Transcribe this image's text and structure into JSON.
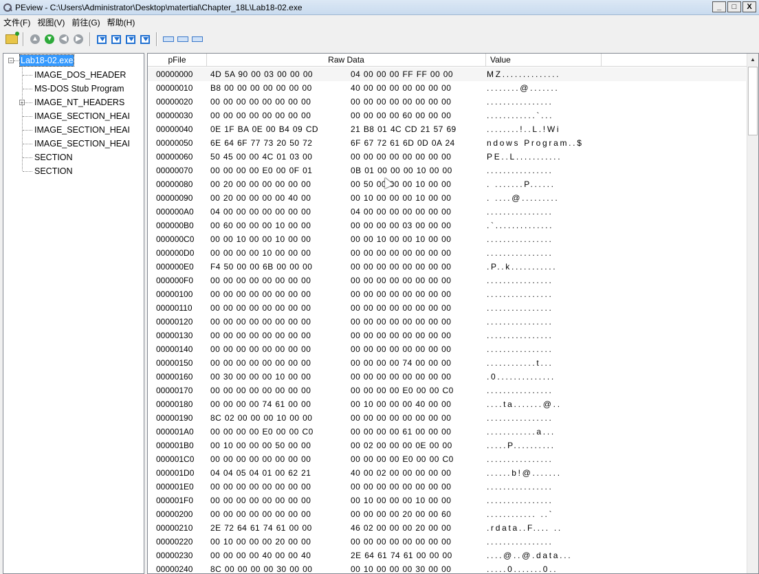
{
  "window": {
    "title": "PEview - C:\\Users\\Administrator\\Desktop\\matertial\\Chapter_18L\\Lab18-02.exe",
    "buttons": {
      "minimize": "_",
      "maximize": "□",
      "close": "X"
    }
  },
  "menu": [
    {
      "label": "文件(F)"
    },
    {
      "label": "视图(V)"
    },
    {
      "label": "前往(G)"
    },
    {
      "label": "帮助(H)"
    }
  ],
  "toolbar": {
    "buttons": [
      "open-file-icon",
      "back-gray-icon",
      "forward-green-icon",
      "prev-gray-icon",
      "next-gray-icon",
      "view-byte-icon",
      "view-word-icon",
      "view-dword-icon",
      "view-address-icon",
      "view-hex-icon",
      "view-ascii-icon",
      "view-sections-icon"
    ]
  },
  "tree": {
    "root": "Lab18-02.exe",
    "items": [
      {
        "label": "IMAGE_DOS_HEADER",
        "expandable": false
      },
      {
        "label": "MS-DOS Stub Program",
        "expandable": false
      },
      {
        "label": "IMAGE_NT_HEADERS",
        "expandable": true
      },
      {
        "label": "IMAGE_SECTION_HEAI",
        "expandable": false
      },
      {
        "label": "IMAGE_SECTION_HEAI",
        "expandable": false
      },
      {
        "label": "IMAGE_SECTION_HEAI",
        "expandable": false
      },
      {
        "label": "SECTION",
        "expandable": false
      },
      {
        "label": "SECTION",
        "expandable": false
      }
    ]
  },
  "hex": {
    "columns": {
      "offset": "pFile",
      "raw": "Raw Data",
      "value": "Value"
    },
    "rows": [
      {
        "off": "00000000",
        "h1": "4D 5A 90 00 03 00 00 00",
        "h2": "04 00 00 00 FF FF 00 00",
        "val": "MZ.............."
      },
      {
        "off": "00000010",
        "h1": "B8 00 00 00 00 00 00 00",
        "h2": "40 00 00 00 00 00 00 00",
        "val": "........@......."
      },
      {
        "off": "00000020",
        "h1": "00 00 00 00 00 00 00 00",
        "h2": "00 00 00 00 00 00 00 00",
        "val": "................"
      },
      {
        "off": "00000030",
        "h1": "00 00 00 00 00 00 00 00",
        "h2": "00 00 00 00 60 00 00 00",
        "val": "............`..."
      },
      {
        "off": "00000040",
        "h1": "0E 1F BA 0E 00 B4 09 CD",
        "h2": "21 B8 01 4C CD 21 57 69",
        "val": "........!..L.!Wi"
      },
      {
        "off": "00000050",
        "h1": "6E 64 6F 77 73 20 50 72",
        "h2": "6F 67 72 61 6D 0D 0A 24",
        "val": "ndows Program..$"
      },
      {
        "off": "00000060",
        "h1": "50 45 00 00 4C 01 03 00",
        "h2": "00 00 00 00 00 00 00 00",
        "val": "PE..L..........."
      },
      {
        "off": "00000070",
        "h1": "00 00 00 00 E0 00 0F 01",
        "h2": "0B 01 00 00 00 10 00 00",
        "val": "................"
      },
      {
        "off": "00000080",
        "h1": "00 20 00 00 00 00 00 00",
        "h2": "00 50 00 00 00 10 00 00",
        "val": ". .......P......"
      },
      {
        "off": "00000090",
        "h1": "00 20 00 00 00 00 40 00",
        "h2": "00 10 00 00 00 10 00 00",
        "val": ". ....@........."
      },
      {
        "off": "000000A0",
        "h1": "04 00 00 00 00 00 00 00",
        "h2": "04 00 00 00 00 00 00 00",
        "val": "................"
      },
      {
        "off": "000000B0",
        "h1": "00 60 00 00 00 10 00 00",
        "h2": "00 00 00 00 03 00 00 00",
        "val": ".`.............."
      },
      {
        "off": "000000C0",
        "h1": "00 00 10 00 00 10 00 00",
        "h2": "00 00 10 00 00 10 00 00",
        "val": "................"
      },
      {
        "off": "000000D0",
        "h1": "00 00 00 00 10 00 00 00",
        "h2": "00 00 00 00 00 00 00 00",
        "val": "................"
      },
      {
        "off": "000000E0",
        "h1": "F4 50 00 00 6B 00 00 00",
        "h2": "00 00 00 00 00 00 00 00",
        "val": ".P..k..........."
      },
      {
        "off": "000000F0",
        "h1": "00 00 00 00 00 00 00 00",
        "h2": "00 00 00 00 00 00 00 00",
        "val": "................"
      },
      {
        "off": "00000100",
        "h1": "00 00 00 00 00 00 00 00",
        "h2": "00 00 00 00 00 00 00 00",
        "val": "................"
      },
      {
        "off": "00000110",
        "h1": "00 00 00 00 00 00 00 00",
        "h2": "00 00 00 00 00 00 00 00",
        "val": "................"
      },
      {
        "off": "00000120",
        "h1": "00 00 00 00 00 00 00 00",
        "h2": "00 00 00 00 00 00 00 00",
        "val": "................"
      },
      {
        "off": "00000130",
        "h1": "00 00 00 00 00 00 00 00",
        "h2": "00 00 00 00 00 00 00 00",
        "val": "................"
      },
      {
        "off": "00000140",
        "h1": "00 00 00 00 00 00 00 00",
        "h2": "00 00 00 00 00 00 00 00",
        "val": "................"
      },
      {
        "off": "00000150",
        "h1": "00 00 00 00 00 00 00 00",
        "h2": "00 00 00 00 74 00 00 00",
        "val": "............t..."
      },
      {
        "off": "00000160",
        "h1": "00 30 00 00 00 10 00 00",
        "h2": "00 00 00 00 00 00 00 00",
        "val": ".0.............."
      },
      {
        "off": "00000170",
        "h1": "00 00 00 00 00 00 00 00",
        "h2": "00 00 00 00 E0 00 00 C0",
        "val": "................"
      },
      {
        "off": "00000180",
        "h1": "00 00 00 00 74 61 00 00",
        "h2": "00 10 00 00 00 40 00 00",
        "val": "....ta.......@.."
      },
      {
        "off": "00000190",
        "h1": "8C 02 00 00 00 10 00 00",
        "h2": "00 00 00 00 00 00 00 00",
        "val": "................"
      },
      {
        "off": "000001A0",
        "h1": "00 00 00 00 E0 00 00 C0",
        "h2": "00 00 00 00 61 00 00 00",
        "val": "............a..."
      },
      {
        "off": "000001B0",
        "h1": "00 10 00 00 00 50 00 00",
        "h2": "00 02 00 00 00 0E 00 00",
        "val": ".....P.........."
      },
      {
        "off": "000001C0",
        "h1": "00 00 00 00 00 00 00 00",
        "h2": "00 00 00 00 E0 00 00 C0",
        "val": "................"
      },
      {
        "off": "000001D0",
        "h1": "04 04 05 04 01 00 62 21",
        "h2": "40 00 02 00 00 00 00 00",
        "val": "......b!@......."
      },
      {
        "off": "000001E0",
        "h1": "00 00 00 00 00 00 00 00",
        "h2": "00 00 00 00 00 00 00 00",
        "val": "................"
      },
      {
        "off": "000001F0",
        "h1": "00 00 00 00 00 00 00 00",
        "h2": "00 10 00 00 00 10 00 00",
        "val": "................"
      },
      {
        "off": "00000200",
        "h1": "00 00 00 00 00 00 00 00",
        "h2": "00 00 00 00 20 00 00 60",
        "val": "............ ..`"
      },
      {
        "off": "00000210",
        "h1": "2E 72 64 61 74 61 00 00",
        "h2": "46 02 00 00 00 20 00 00",
        "val": ".rdata..F.... .."
      },
      {
        "off": "00000220",
        "h1": "00 10 00 00 00 20 00 00",
        "h2": "00 00 00 00 00 00 00 00",
        "val": "................"
      },
      {
        "off": "00000230",
        "h1": "00 00 00 00 40 00 00 40",
        "h2": "2E 64 61 74 61 00 00 00",
        "val": "....@..@.data..."
      },
      {
        "off": "00000240",
        "h1": "8C 00 00 00 00 30 00 00",
        "h2": "00 10 00 00 00 30 00 00",
        "val": ".....0.......0.."
      }
    ]
  }
}
